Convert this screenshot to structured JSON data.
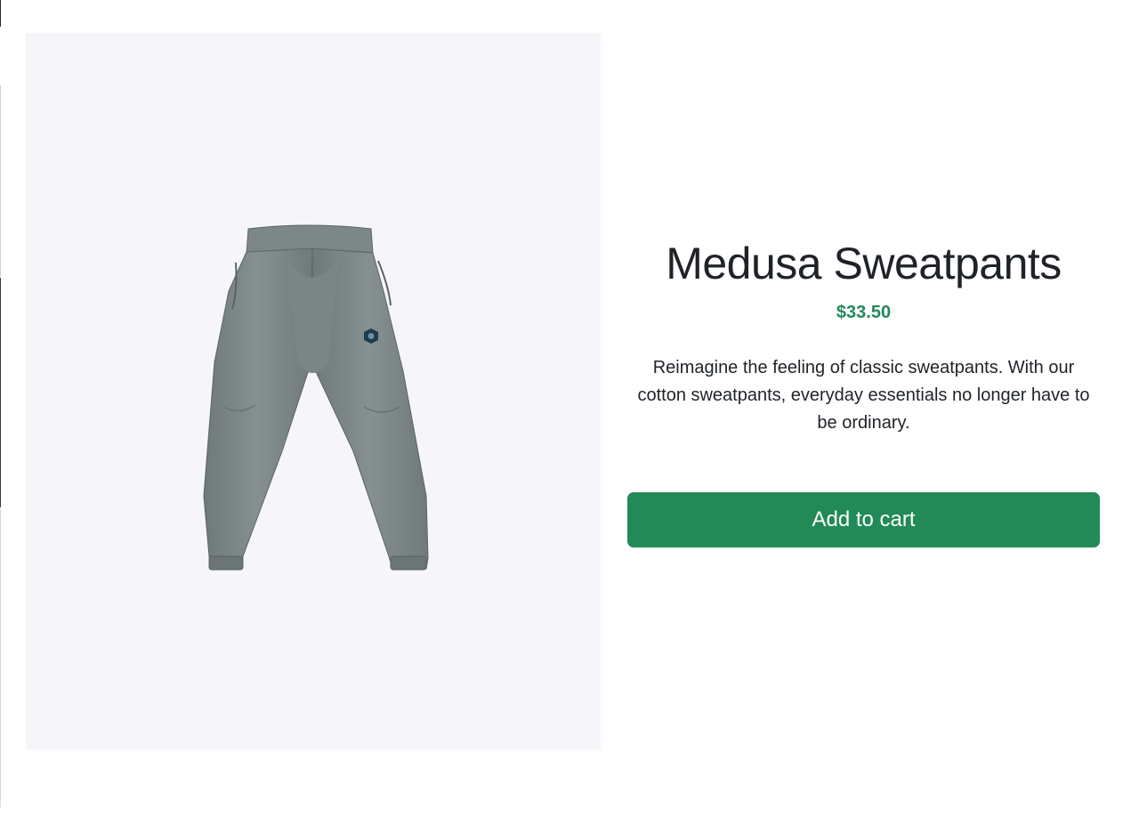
{
  "product": {
    "title": "Medusa Sweatpants",
    "price": "$33.50",
    "description": "Reimagine the feeling of classic sweatpants. With our cotton sweatpants, everyday essentials no longer have to be ordinary.",
    "add_to_cart_label": "Add to cart",
    "image_icon": "sweatpants-product-image"
  },
  "colors": {
    "price": "#23895a",
    "button_bg": "#228a57",
    "image_panel_bg": "#f6f6fa",
    "garment": "#7a8485",
    "logo": "#1d3b4f"
  }
}
